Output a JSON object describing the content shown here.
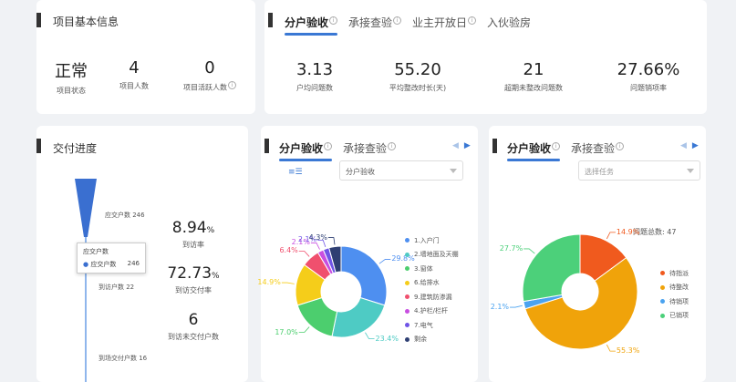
{
  "project": {
    "title": "项目基本信息",
    "stats": [
      {
        "value": "正常",
        "label": "项目状态"
      },
      {
        "value": "4",
        "label": "项目人数"
      },
      {
        "value": "0",
        "label": "项目活跃人数"
      }
    ]
  },
  "top_right": {
    "tabs": [
      "分户验收",
      "承接查验",
      "业主开放日",
      "入伙验房"
    ],
    "stats": [
      {
        "value": "3.13",
        "label": "户均问题数"
      },
      {
        "value": "55.20",
        "label": "平均整改时长(天)"
      },
      {
        "value": "21",
        "label": "超期未整改问题数"
      },
      {
        "value": "27.66%",
        "label": "问题销项率"
      }
    ]
  },
  "delivery": {
    "title": "交付进度",
    "funnel_labels": [
      "应交户数 246",
      "到访户数 22",
      "到场交付户数 16"
    ],
    "tooltip": {
      "title": "应交户数",
      "row_label": "应交户数",
      "row_value": "246"
    },
    "metrics": [
      {
        "value": "8.94",
        "unit": "%",
        "label": "到访率"
      },
      {
        "value": "72.73",
        "unit": "%",
        "label": "到访交付率"
      },
      {
        "value": "6",
        "unit": "",
        "label": "到访未交付户数"
      }
    ]
  },
  "mid": {
    "tabs": [
      "分户验收",
      "承接查验"
    ],
    "small_icon": "≡☰",
    "select_value": "分户验收",
    "icons": {
      "prev": "triangle-left-icon",
      "next": "triangle-right-icon"
    }
  },
  "right": {
    "tabs": [
      "分户验收",
      "承接查验"
    ],
    "select_placeholder": "选择任务",
    "total_label": "问题总数: 47"
  },
  "chart_data": [
    {
      "type": "pie",
      "donut": true,
      "categories": [
        "1.入户门",
        "2.墙地面及天棚",
        "3.窗体",
        "6.给排水",
        "9.建筑防渗漏",
        "4.护栏/栏杆",
        "7.电气",
        "剩余"
      ],
      "values": [
        29.8,
        23.4,
        17.0,
        14.9,
        6.4,
        2.1,
        2.1,
        4.3
      ],
      "data_labels": [
        "29.8%",
        "23.4%",
        "17.0%",
        "14.9%",
        "6.4%",
        "2.1%",
        "2.1%",
        "4.3%"
      ],
      "colors": [
        "#4e8ff0",
        "#4ecbc4",
        "#4cce6e",
        "#f5cd1a",
        "#f0506e",
        "#c84ee0",
        "#6f54e6",
        "#2e3f73"
      ],
      "legend": "right"
    },
    {
      "type": "pie",
      "donut": true,
      "categories": [
        "待指派",
        "待整改",
        "待销项",
        "已销项"
      ],
      "values": [
        14.9,
        55.3,
        2.1,
        27.7
      ],
      "data_labels": [
        "14.9%",
        "55.3%",
        "2.1%",
        "27.7%"
      ],
      "colors": [
        "#f05a1e",
        "#f0a30a",
        "#4aa3f0",
        "#4cd07a"
      ],
      "legend": "right"
    }
  ]
}
